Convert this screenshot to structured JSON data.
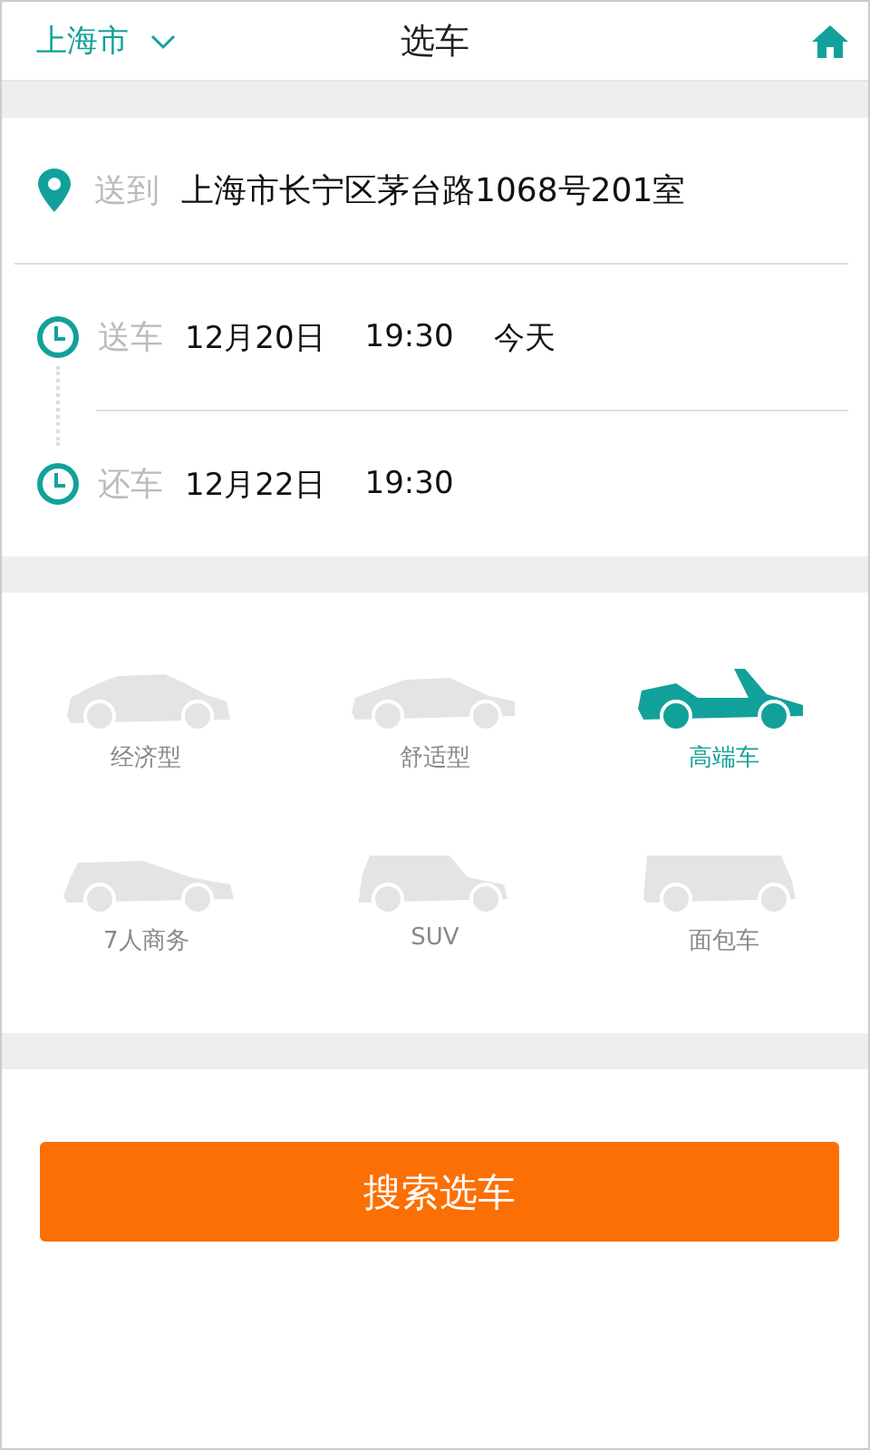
{
  "header": {
    "city": "上海市",
    "title": "选车"
  },
  "delivery": {
    "label": "送到",
    "address": "上海市长宁区茅台路1068号201室"
  },
  "times": [
    {
      "label": "送车",
      "date": "12月20日",
      "time": "19:30",
      "note": "今天"
    },
    {
      "label": "还车",
      "date": "12月22日",
      "time": "19:30"
    }
  ],
  "car_types": [
    {
      "kind": "suv",
      "label": "经济型",
      "selected": false
    },
    {
      "kind": "sedan",
      "label": "舒适型",
      "selected": false
    },
    {
      "kind": "convertible",
      "label": "高端车",
      "selected": true
    },
    {
      "kind": "wagon",
      "label": "7人商务",
      "selected": false
    },
    {
      "kind": "boxy",
      "label": "SUV",
      "selected": false
    },
    {
      "kind": "van",
      "label": "面包车",
      "selected": false
    }
  ],
  "search_button": "搜索选车"
}
